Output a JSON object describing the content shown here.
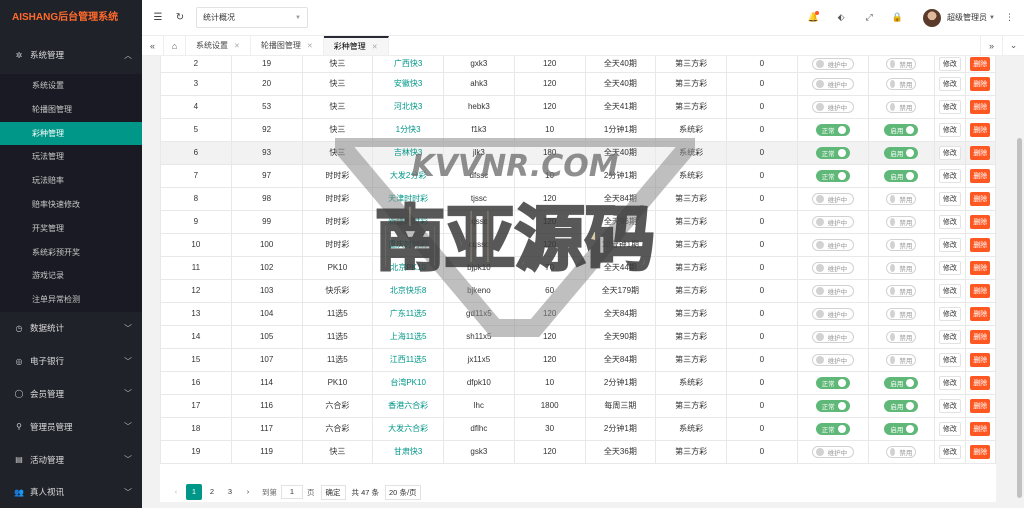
{
  "app": {
    "logo": "AISHANG后台管理系统"
  },
  "sidebar": {
    "group_system": "系统管理",
    "sub_items": [
      "系统设置",
      "轮播图管理",
      "彩种管理",
      "玩法管理",
      "玩法赔率",
      "赔率快速修改",
      "开奖管理",
      "系统彩预开奖",
      "游戏记录",
      "注单异常检测"
    ],
    "lower_groups": [
      "数据统计",
      "电子银行",
      "会员管理",
      "管理员管理",
      "活动管理",
      "真人视讯"
    ]
  },
  "header": {
    "select_value": "统计概况",
    "user": "超级管理员"
  },
  "tabs": [
    "系统设置",
    "轮播图管理",
    "彩种管理"
  ],
  "table": {
    "switch_labels": {
      "maint": "维护中",
      "normal": "正常",
      "disabled": "禁用",
      "enabled": "启用"
    },
    "edit_label": "修改",
    "delete_label": "删除",
    "rows": [
      [
        "2",
        "19",
        "快三",
        "广西快3",
        "gxk3",
        "120",
        "全天40期",
        "第三方彩",
        "0"
      ],
      [
        "3",
        "20",
        "快三",
        "安徽快3",
        "ahk3",
        "120",
        "全天40期",
        "第三方彩",
        "0"
      ],
      [
        "4",
        "53",
        "快三",
        "河北快3",
        "hebk3",
        "120",
        "全天41期",
        "第三方彩",
        "0"
      ],
      [
        "5",
        "92",
        "快三",
        "1分快3",
        "f1k3",
        "10",
        "1分钟1期",
        "系统彩",
        "0"
      ],
      [
        "6",
        "93",
        "快三",
        "吉林快3",
        "jlk3",
        "180",
        "全天40期",
        "系统彩",
        "0"
      ],
      [
        "7",
        "97",
        "时时彩",
        "大发2分彩",
        "dfssc",
        "10",
        "2分钟1期",
        "系统彩",
        "0"
      ],
      [
        "8",
        "98",
        "时时彩",
        "天津时时彩",
        "tjssc",
        "120",
        "全天84期",
        "第三方彩",
        "0"
      ],
      [
        "9",
        "99",
        "时时彩",
        "新疆时时彩",
        "xjssc",
        "120",
        "全天96期",
        "第三方彩",
        "0"
      ],
      [
        "10",
        "100",
        "时时彩",
        "重庆时时彩",
        "cqssc",
        "120",
        "10分钟1期",
        "第三方彩",
        "0"
      ],
      [
        "11",
        "102",
        "PK10",
        "北京PK10",
        "bjpk10",
        "70",
        "全天44期",
        "第三方彩",
        "0"
      ],
      [
        "12",
        "103",
        "快乐彩",
        "北京快乐8",
        "bjkeno",
        "60",
        "全天179期",
        "第三方彩",
        "0"
      ],
      [
        "13",
        "104",
        "11选5",
        "广东11选5",
        "gd11x5",
        "120",
        "全天84期",
        "第三方彩",
        "0"
      ],
      [
        "14",
        "105",
        "11选5",
        "上海11选5",
        "sh11x5",
        "120",
        "全天90期",
        "第三方彩",
        "0"
      ],
      [
        "15",
        "107",
        "11选5",
        "江西11选5",
        "jx11x5",
        "120",
        "全天84期",
        "第三方彩",
        "0"
      ],
      [
        "16",
        "114",
        "PK10",
        "台湾PK10",
        "dfpk10",
        "10",
        "2分钟1期",
        "系统彩",
        "0"
      ],
      [
        "17",
        "116",
        "六合彩",
        "香港六合彩",
        "lhc",
        "1800",
        "每周三期",
        "第三方彩",
        "0"
      ],
      [
        "18",
        "117",
        "六合彩",
        "大发六合彩",
        "dflhc",
        "30",
        "2分钟1期",
        "系统彩",
        "0"
      ],
      [
        "19",
        "119",
        "快三",
        "甘肃快3",
        "gsk3",
        "120",
        "全天36期",
        "第三方彩",
        "0"
      ]
    ],
    "row_status_on": [
      false,
      false,
      false,
      true,
      true,
      true,
      false,
      false,
      false,
      false,
      false,
      false,
      false,
      false,
      true,
      true,
      true,
      false
    ]
  },
  "pager": {
    "pages": [
      "1",
      "2",
      "3"
    ],
    "goto_label": "到第",
    "goto_value": "1",
    "page_unit": "页",
    "confirm": "确定",
    "total": "共 47 条",
    "per_page": "20 条/页"
  },
  "watermark": {
    "text_latin": "KVVNR.COM",
    "text_cn": "南亚源码"
  }
}
